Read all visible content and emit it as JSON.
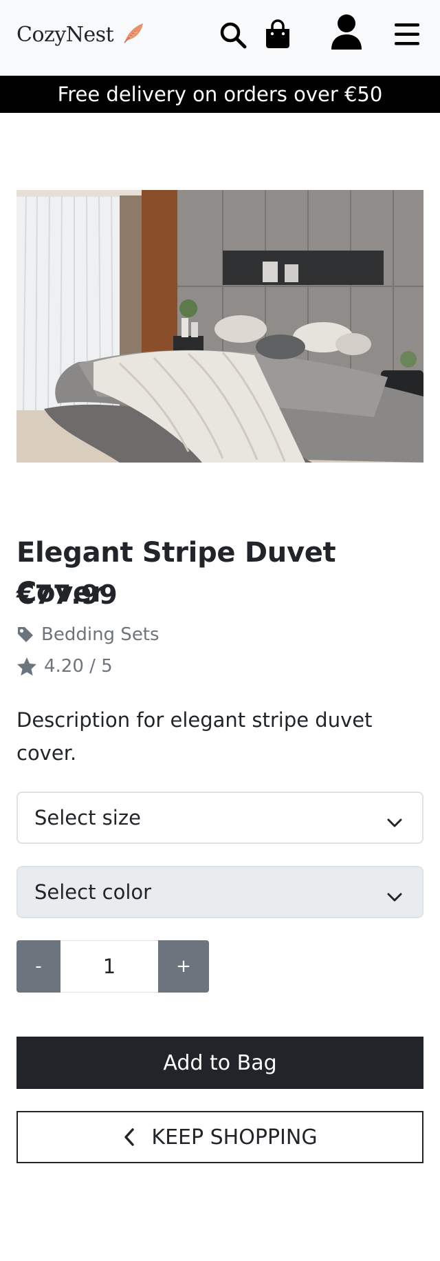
{
  "header": {
    "brand": "CozyNest",
    "icons": [
      "feather-icon",
      "search-icon",
      "shopping-bag-icon",
      "user-icon",
      "menu-icon"
    ]
  },
  "banner": {
    "text": "Free delivery on orders over €50"
  },
  "product": {
    "title": "Elegant Stripe Duvet Cover",
    "price": "€77.99",
    "category": "Bedding Sets",
    "rating": "4.20 / 5",
    "description": "Description for elegant stripe duvet cover.",
    "image_subject": "bedroom-with-grey-duvet-and-knit-throw"
  },
  "options": {
    "size_placeholder": "Select size",
    "color_placeholder": "Select color"
  },
  "quantity": {
    "minus_label": "-",
    "value": "1",
    "plus_label": "+"
  },
  "actions": {
    "add_to_bag": "Add to Bag",
    "keep_shopping": "KEEP SHOPPING"
  },
  "colors": {
    "navbar_bg": "#f8f9fa",
    "banner_bg": "#000000",
    "dark": "#212529",
    "muted": "#6c757d",
    "feather": "#e8916a"
  }
}
